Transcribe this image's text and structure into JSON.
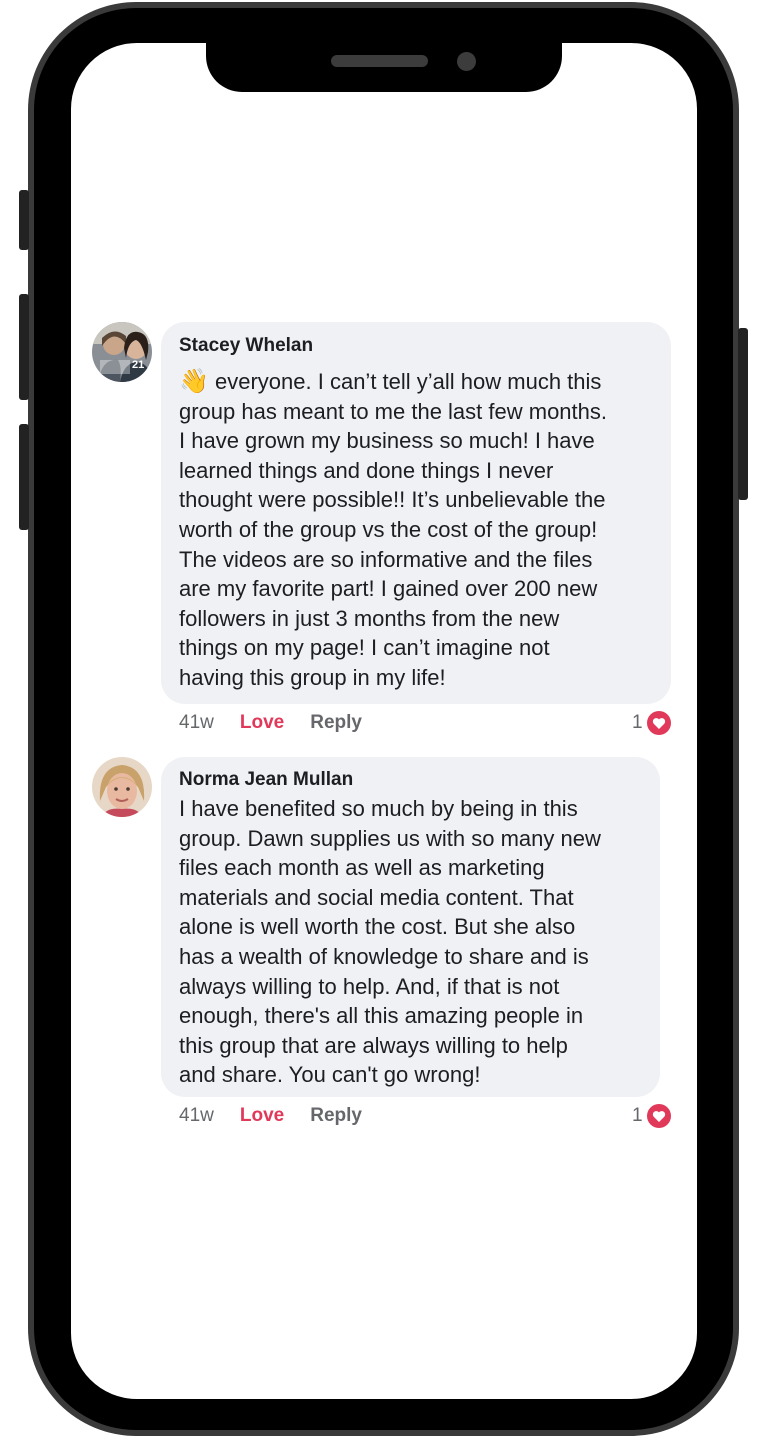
{
  "comments": [
    {
      "author": "Stacey Whelan",
      "emoji": "👋",
      "text": " everyone.  I can’t tell y’all how much this\ngroup has meant to me the last few months.\nI have grown my business so much! I have\nlearned things and done things I never\nthought were possible!! It’s unbelievable the\nworth of the group vs the cost of the group!\nThe videos are so informative and the files\nare my favorite part! I gained over 200 new\nfollowers in just 3 months from the new\nthings on my page! I can’t imagine not\nhaving this group in my life!",
      "time": "41w",
      "love_label": "Love",
      "reply_label": "Reply",
      "reaction_count": "1",
      "avatar_badge": "21"
    },
    {
      "author": "Norma Jean Mullan",
      "text": "I have benefited so much by being in this\ngroup. Dawn supplies us with so many new\nfiles each month as well as marketing\nmaterials and social media content.  That\nalone is well worth the cost. But she also\nhas a wealth of knowledge to share and is\nalways willing to help. And, if that is not\nenough,  there's all this amazing people in\nthis group that are always willing to help\nand share. You can't go wrong!",
      "time": "41w",
      "love_label": "Love",
      "reply_label": "Reply",
      "reaction_count": "1"
    }
  ],
  "colors": {
    "bubble": "#f0f1f4",
    "love": "#e0395a",
    "muted": "#65676b",
    "text": "#1c1e21"
  }
}
